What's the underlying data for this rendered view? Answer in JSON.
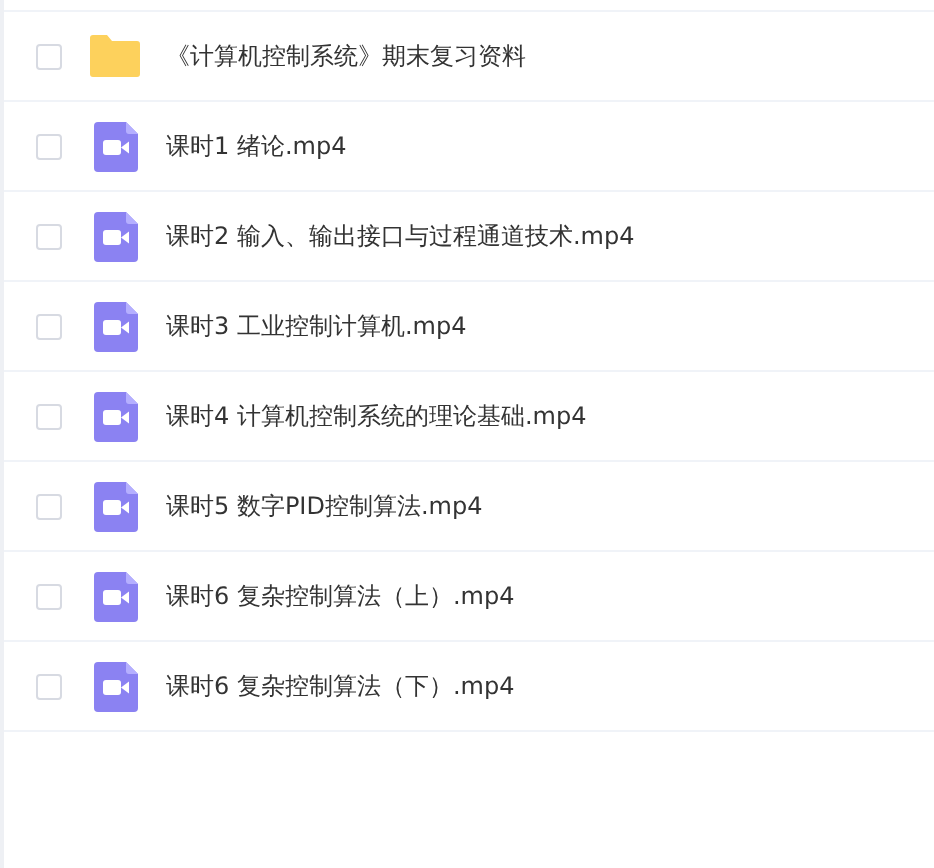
{
  "files": [
    {
      "kind": "folder",
      "name": "《计算机控制系统》期末复习资料",
      "checked": false
    },
    {
      "kind": "video",
      "name": "课时1 绪论.mp4",
      "checked": false
    },
    {
      "kind": "video",
      "name": "课时2 输入、输出接口与过程通道技术.mp4",
      "checked": false
    },
    {
      "kind": "video",
      "name": "课时3 工业控制计算机.mp4",
      "checked": false
    },
    {
      "kind": "video",
      "name": "课时4 计算机控制系统的理论基础.mp4",
      "checked": false
    },
    {
      "kind": "video",
      "name": "课时5 数字PID控制算法.mp4",
      "checked": false
    },
    {
      "kind": "video",
      "name": "课时6 复杂控制算法（上）.mp4",
      "checked": false
    },
    {
      "kind": "video",
      "name": "课时6 复杂控制算法（下）.mp4",
      "checked": false
    }
  ]
}
